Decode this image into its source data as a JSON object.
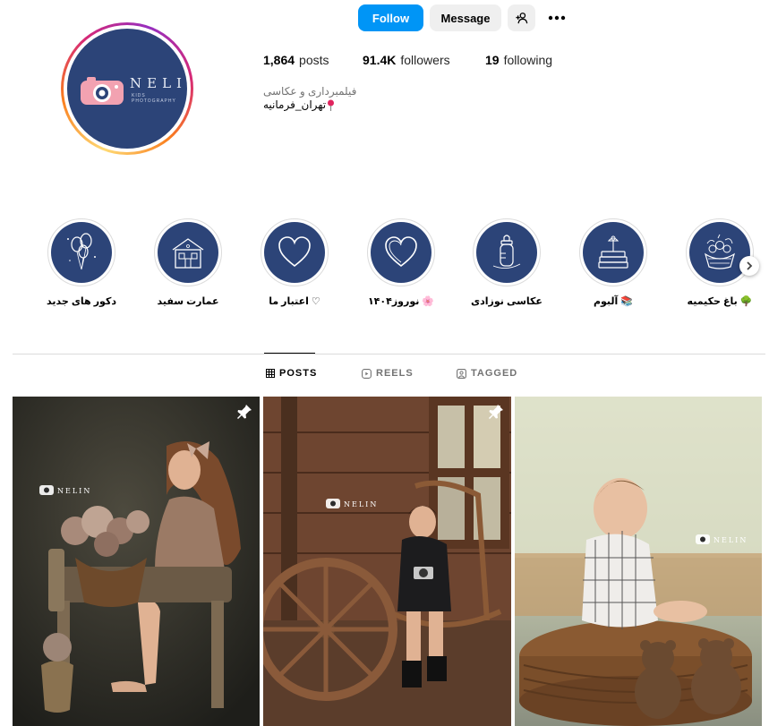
{
  "profile": {
    "follow_label": "Follow",
    "message_label": "Message",
    "logo_text": "NELIN",
    "logo_subtext": "KIDS PHOTOGRAPHY",
    "stats": {
      "posts_count": "1,864",
      "posts_label": "posts",
      "followers_count": "91.4K",
      "followers_label": "followers",
      "following_count": "19",
      "following_label": "following"
    },
    "bio": {
      "category": "فیلمبرداری و عکاسی",
      "location": "تهران_فرمانیه"
    }
  },
  "highlights": [
    {
      "label": "دکور های جدید",
      "icon": "balloons-icon"
    },
    {
      "label": "عمارت سفید",
      "icon": "house-icon"
    },
    {
      "label": "اعتبار ما",
      "icon": "heart-icon",
      "emoji": "♡"
    },
    {
      "label": "نوروز۱۴۰۴",
      "icon": "heart-icon",
      "emoji": "🌸"
    },
    {
      "label": "عکاسی نوزادی",
      "icon": "baby-bottle-icon"
    },
    {
      "label": "آلبوم",
      "icon": "book-stack-icon",
      "emoji": "📚"
    },
    {
      "label": "باغ حکیمیه",
      "icon": "flower-basket-icon",
      "emoji": "🌳"
    }
  ],
  "tabs": {
    "posts": "POSTS",
    "reels": "REELS",
    "tagged": "TAGGED"
  },
  "posts": [
    {
      "alt": "girl with flower basket",
      "pinned": true,
      "watermark": "NELIN"
    },
    {
      "alt": "boy with camera on rocking chair",
      "pinned": true,
      "watermark": "NELIN"
    },
    {
      "alt": "baby sitting on wicker pouf",
      "pinned": false,
      "watermark": "NELIN"
    }
  ],
  "colors": {
    "accent": "#0095f6",
    "brand_navy": "#2c4478",
    "muted_text": "#737373",
    "border": "#dbdbdb"
  }
}
